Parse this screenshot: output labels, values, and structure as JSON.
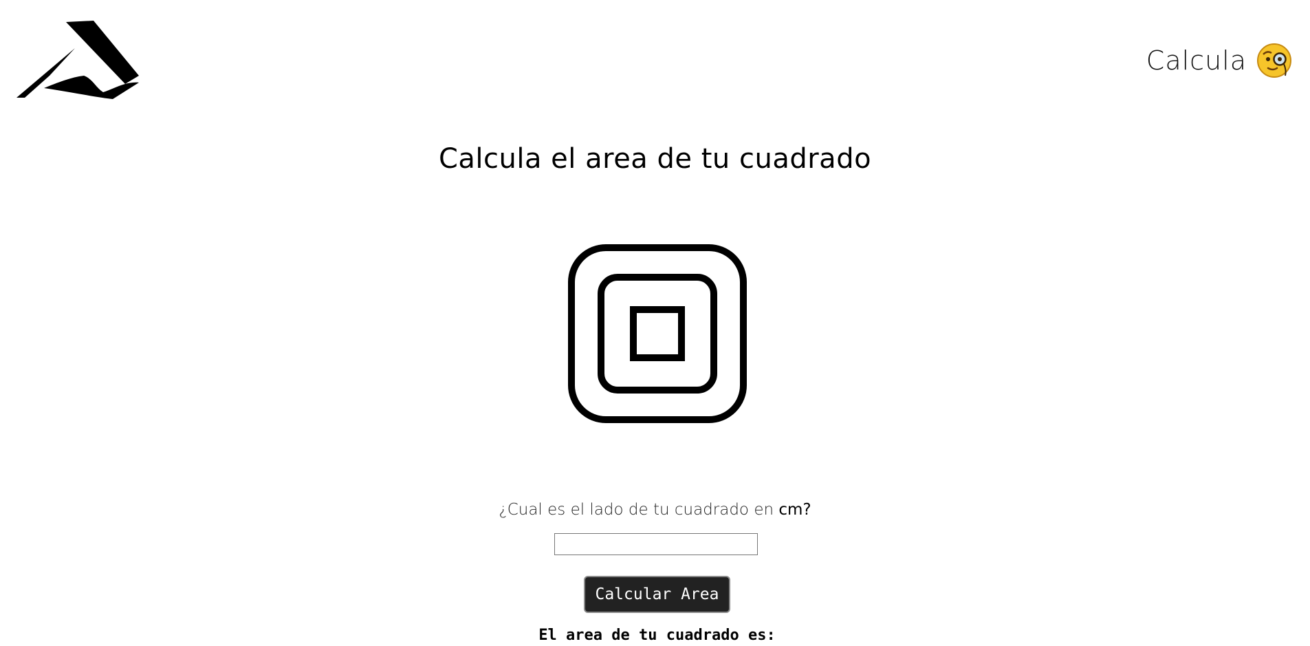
{
  "header": {
    "brand_label": "Calcula",
    "brand_emoji_icon": "face-with-monocle-icon",
    "logo_icon": "abstract-mountain-logo-icon"
  },
  "main": {
    "title": "Calcula el area de tu cuadrado",
    "illustration_icon": "nested-squares-icon",
    "question_prefix": "¿Cual es el lado de tu cuadrado en ",
    "question_unit": "cm?",
    "side_input_value": "",
    "side_input_placeholder": "",
    "calculate_button_label": "Calcular Area",
    "result_label": "El area de tu cuadrado es:"
  },
  "colors": {
    "button_background": "#222222",
    "button_text": "#ffffff",
    "emoji_face": "#f6c42a"
  }
}
